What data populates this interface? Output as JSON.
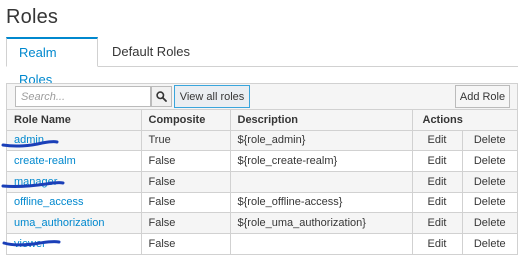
{
  "page": {
    "title": "Roles"
  },
  "tabs": [
    {
      "label": "Realm Roles",
      "active": true
    },
    {
      "label": "Default Roles",
      "active": false
    }
  ],
  "toolbar": {
    "search_placeholder": "Search...",
    "search_icon": "magnifier-icon",
    "view_all_label": "View all roles",
    "add_role_label": "Add Role"
  },
  "table": {
    "headers": {
      "name": "Role Name",
      "composite": "Composite",
      "description": "Description",
      "actions": "Actions"
    },
    "rows": [
      {
        "name": "admin",
        "composite": "True",
        "description": "${role_admin}",
        "edit": "Edit",
        "delete": "Delete"
      },
      {
        "name": "create-realm",
        "composite": "False",
        "description": "${role_create-realm}",
        "edit": "Edit",
        "delete": "Delete"
      },
      {
        "name": "manager",
        "composite": "False",
        "description": "",
        "edit": "Edit",
        "delete": "Delete"
      },
      {
        "name": "offline_access",
        "composite": "False",
        "description": "${role_offline-access}",
        "edit": "Edit",
        "delete": "Delete"
      },
      {
        "name": "uma_authorization",
        "composite": "False",
        "description": "${role_uma_authorization}",
        "edit": "Edit",
        "delete": "Delete"
      },
      {
        "name": "viewer",
        "composite": "False",
        "description": "",
        "edit": "Edit",
        "delete": "Delete"
      }
    ]
  },
  "colors": {
    "accent": "#0088ce",
    "annotation": "#1a3fb8"
  },
  "annotations": {
    "underlined_rows": [
      "admin",
      "manager",
      "viewer"
    ]
  }
}
